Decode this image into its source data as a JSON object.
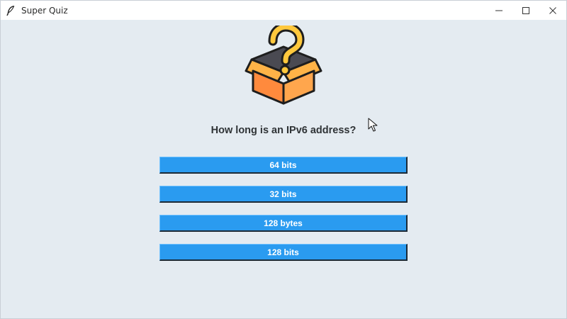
{
  "window": {
    "title": "Super Quiz"
  },
  "quiz": {
    "question": "How long is an IPv6 address?",
    "answers": [
      {
        "label": "64 bits"
      },
      {
        "label": "32 bits"
      },
      {
        "label": "128 bytes"
      },
      {
        "label": "128 bits"
      }
    ]
  },
  "icons": {
    "app": "feather-icon",
    "logo": "question-mark-box-icon",
    "minimize": "minimize-icon",
    "maximize": "maximize-icon",
    "close": "close-icon"
  },
  "colors": {
    "background": "#e4ebf1",
    "button": "#2a9bf0",
    "button_text": "#ffffff",
    "question_text": "#2f3336"
  }
}
